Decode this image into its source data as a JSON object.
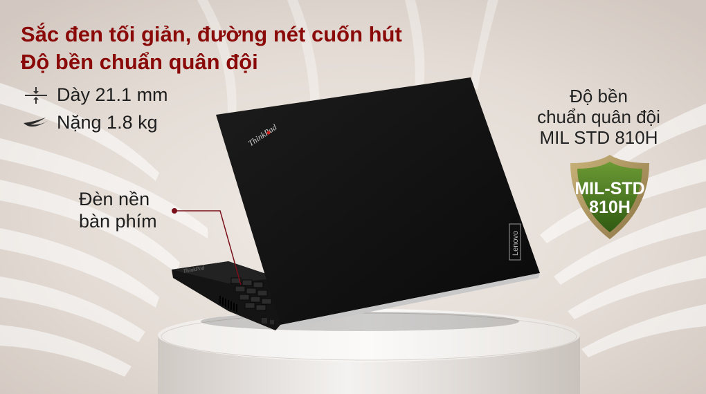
{
  "headline": {
    "line1": "Sắc đen tối giản, đường nét cuốn hút",
    "line2": "Độ bền chuẩn quân đội"
  },
  "specs": [
    {
      "icon": "thickness-icon",
      "label": "Dày 21.1 mm"
    },
    {
      "icon": "feather-icon",
      "label": "Nặng 1.8 kg"
    }
  ],
  "callout": {
    "line1": "Đèn nền",
    "line2": "bàn phím"
  },
  "durability": {
    "line1": "Độ bền",
    "line2": "chuẩn quân đội",
    "line3": "MIL STD 810H"
  },
  "badge": {
    "line1": "MIL-STD",
    "line2": "810H"
  },
  "laptop": {
    "brand_lid": "ThinkPad",
    "brand_side": "Lenovo"
  },
  "colors": {
    "headline": "#8a0a0a",
    "badge_fill": "#4b7a1e",
    "badge_border": "#a88f55",
    "callout_line": "#7a0f1a"
  }
}
